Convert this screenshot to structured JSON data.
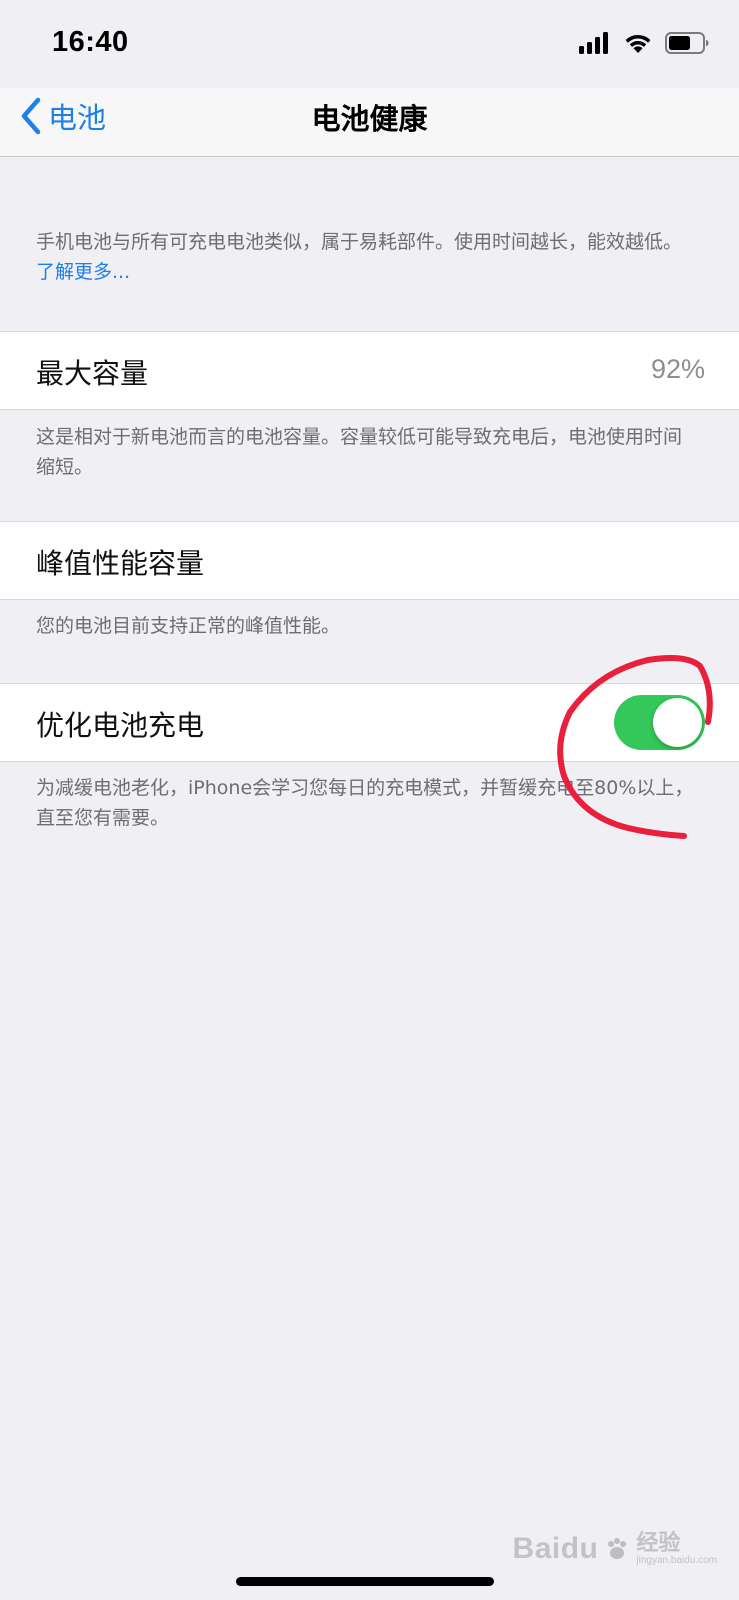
{
  "status_bar": {
    "time": "16:40",
    "icons": [
      "cellular-signal-icon",
      "wifi-icon",
      "battery-icon"
    ]
  },
  "nav": {
    "back_label": "电池",
    "title": "电池健康"
  },
  "intro": {
    "text": "手机电池与所有可充电电池类似，属于易耗部件。使用时间越长，能效越低。",
    "link": "了解更多..."
  },
  "max_capacity": {
    "label": "最大容量",
    "value": "92%",
    "footer": "这是相对于新电池而言的电池容量。容量较低可能导致充电后，电池使用时间缩短。"
  },
  "peak_performance": {
    "label": "峰值性能容量",
    "footer": "您的电池目前支持正常的峰值性能。"
  },
  "optimized_charging": {
    "label": "优化电池充电",
    "enabled": true,
    "footer": "为减缓电池老化，iPhone会学习您每日的充电模式，并暂缓充电至80%以上，直至您有需要。"
  },
  "watermark": {
    "brand": "Baidu",
    "cn": "经验",
    "url": "jingyan.baidu.com"
  },
  "colors": {
    "accent": "#1f7fe8",
    "toggle_on": "#34c759",
    "annotation": "#e8203c",
    "background": "#efeff4"
  }
}
